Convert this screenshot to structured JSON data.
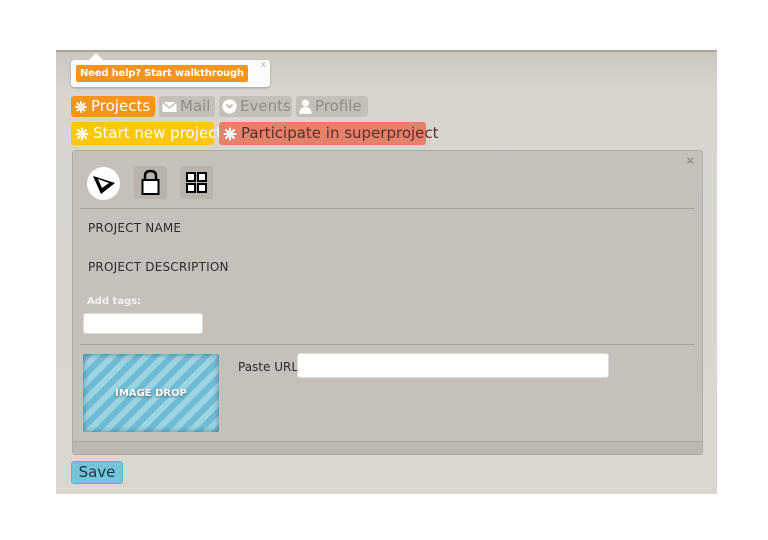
{
  "help_popup": {
    "button_label": "Need help? Start walkthrough",
    "close_label": "x"
  },
  "tabs": [
    {
      "label": "Projects",
      "icon": "asterisk-icon",
      "active": true
    },
    {
      "label": "Mail",
      "icon": "envelope-icon",
      "active": false
    },
    {
      "label": "Events",
      "icon": "clock-icon",
      "active": false
    },
    {
      "label": "Profile",
      "icon": "person-icon",
      "active": false
    }
  ],
  "actions": {
    "start_new": "Start new project",
    "participate": "Participate in superproject"
  },
  "panel": {
    "close_label": "×",
    "toolbar_icons": [
      "send-icon",
      "lock-icon",
      "grid-icon"
    ],
    "project_name_label": "PROJECT NAME",
    "project_description_label": "PROJECT DESCRIPTION",
    "tags_label": "Add tags:",
    "tags_value": "",
    "image_drop_label": "IMAGE DROP",
    "paste_url_label": "Paste URL",
    "paste_url_value": ""
  },
  "save_label": "Save",
  "colors": {
    "projects_tab": "#f7941d",
    "start_new": "#fdc70a",
    "participate": "#e5816a",
    "save": "#75c4d9"
  }
}
